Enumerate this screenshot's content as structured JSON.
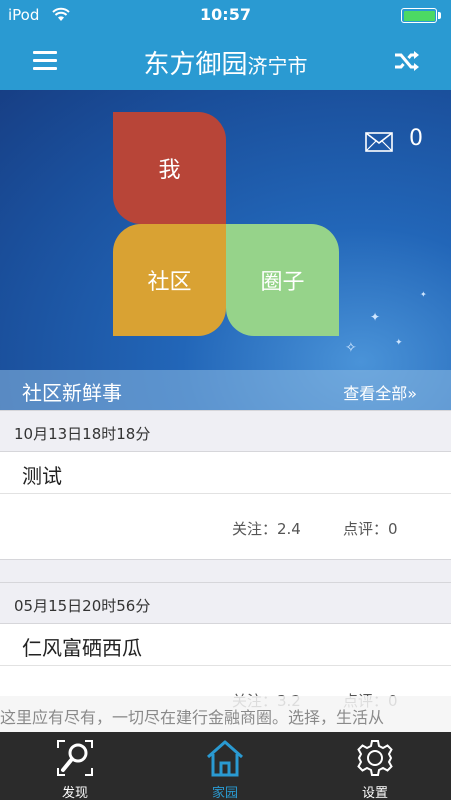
{
  "status_bar": {
    "carrier": "iPod",
    "time": "10:57",
    "battery_level": 1.0
  },
  "nav": {
    "title": "东方御园",
    "subtitle": "济宁市",
    "menu_icon": "menu-icon",
    "shuffle_icon": "shuffle-icon"
  },
  "hero": {
    "tiles": {
      "me": "我",
      "community": "社区",
      "circle": "圈子"
    },
    "mail_count": "0",
    "news_title": "社区新鲜事",
    "news_more": "查看全部»"
  },
  "posts": [
    {
      "date": "10月13日18时18分",
      "title": "测试",
      "follow": "关注：2.4",
      "comment": "点评：0"
    },
    {
      "date": "05月15日20时56分",
      "title": "仁风富硒西瓜",
      "follow": "关注：3.2",
      "comment": "点评：0"
    }
  ],
  "marquee": "这里应有尽有，一切尽在建行金融商圈。选择，生活从",
  "tabs": [
    {
      "label": "发现",
      "icon": "search-icon"
    },
    {
      "label": "家园",
      "icon": "home-icon"
    },
    {
      "label": "设置",
      "icon": "gear-icon"
    }
  ],
  "colors": {
    "primary": "#2a9ad2",
    "tile_me": "#b84538",
    "tile_community": "#d9a233",
    "tile_circle": "#96d38a",
    "tab_bar": "#2b2b2b"
  }
}
